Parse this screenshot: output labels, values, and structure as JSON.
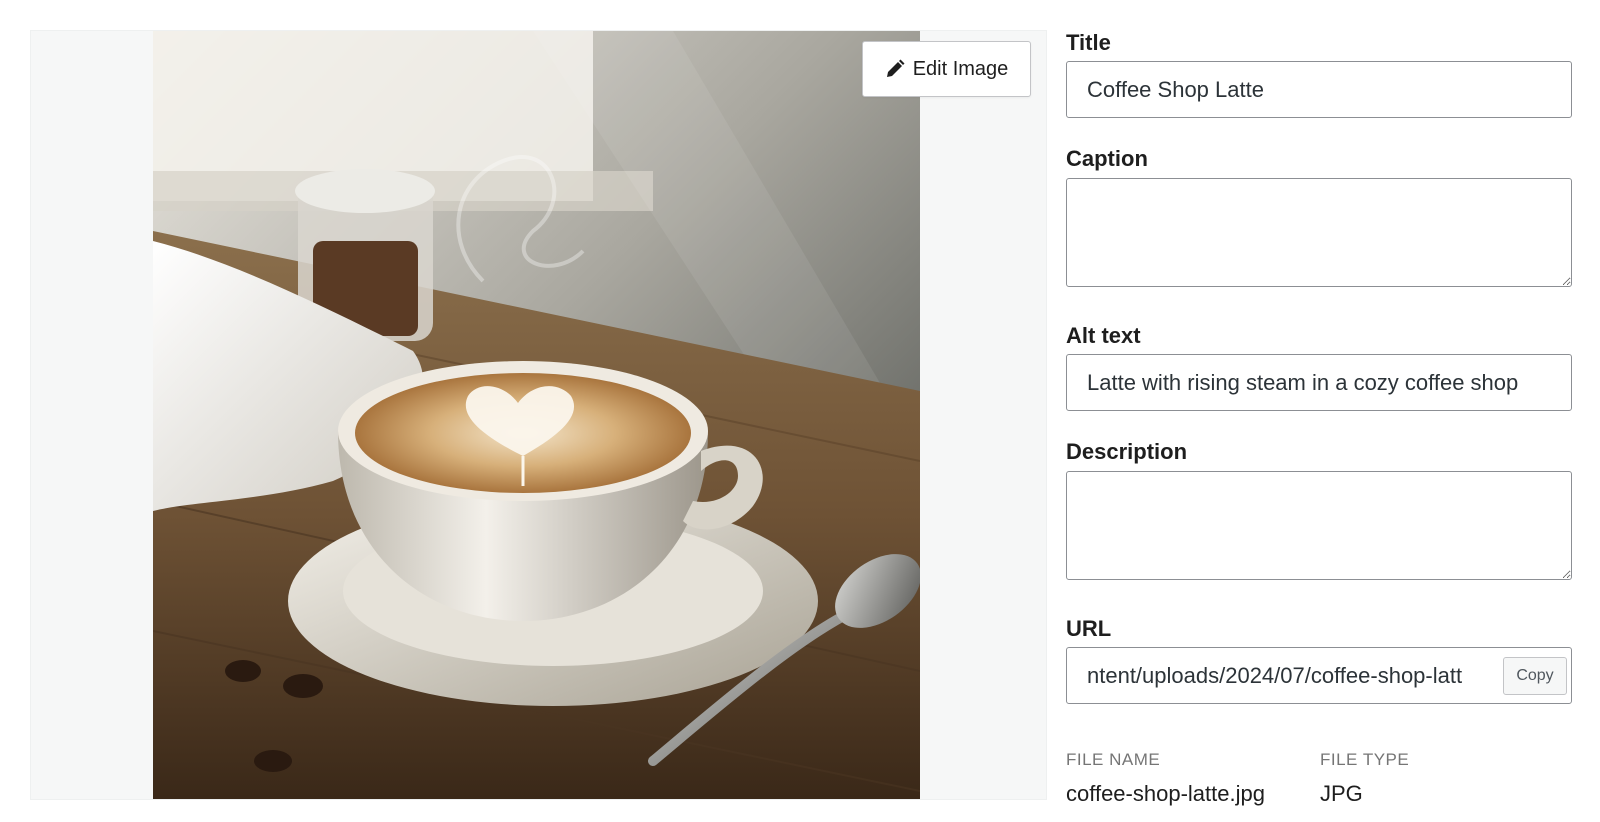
{
  "preview": {
    "edit_button_label": "Edit Image",
    "image_icon": "coffee-photo"
  },
  "fields": {
    "title": {
      "label": "Title",
      "value": "Coffee Shop Latte"
    },
    "caption": {
      "label": "Caption",
      "value": ""
    },
    "alt_text": {
      "label": "Alt text",
      "value": "Latte with rising steam in a cozy coffee shop"
    },
    "description": {
      "label": "Description",
      "value": ""
    },
    "url": {
      "label": "URL",
      "visible_value": "ntent/uploads/2024/07/coffee-shop-latt",
      "copy_label": "Copy"
    }
  },
  "meta": {
    "file_name_label": "FILE NAME",
    "file_name": "coffee-shop-latte.jpg",
    "file_type_label": "FILE TYPE",
    "file_type": "JPG"
  },
  "colors": {
    "panel_bg": "#f6f7f7",
    "border": "#8c8f94",
    "text": "#1e1e1e",
    "muted": "#757575"
  }
}
